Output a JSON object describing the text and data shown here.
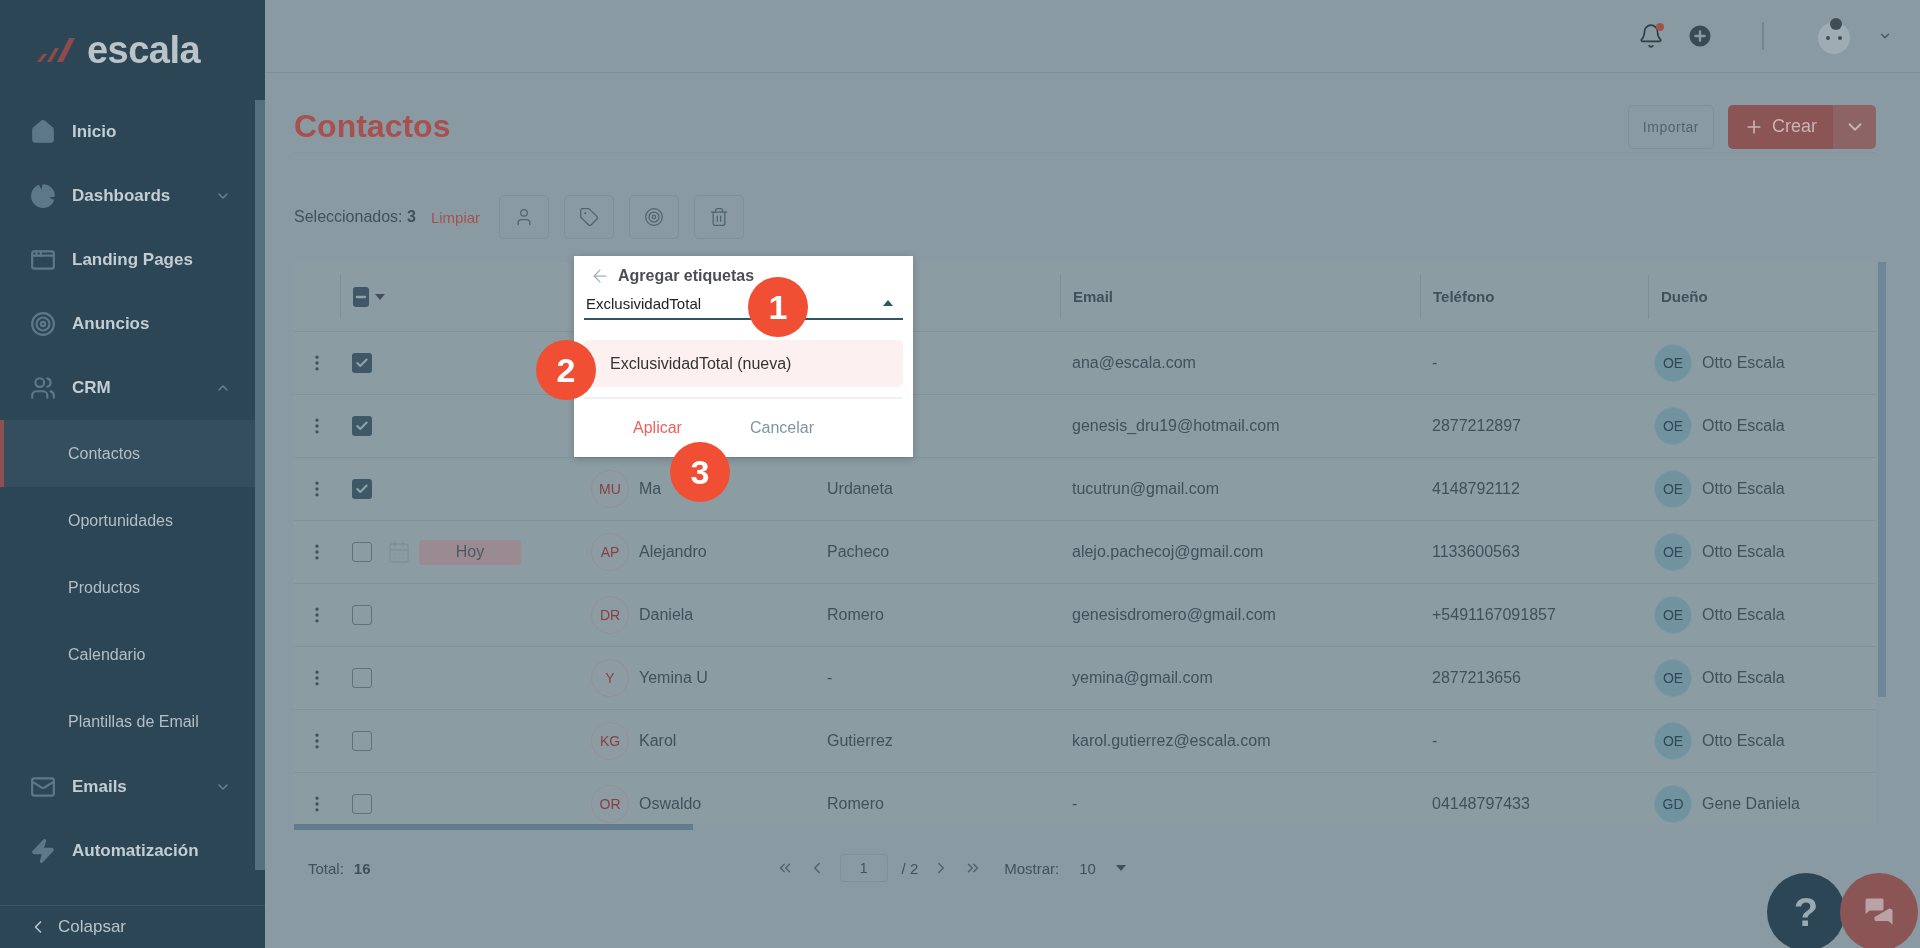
{
  "sidebar": {
    "logo": "escala",
    "items": [
      {
        "kind": "section",
        "label": "Inicio",
        "selected": false
      },
      {
        "kind": "section",
        "label": "Dashboards",
        "selected": false,
        "expanded": false
      },
      {
        "kind": "section",
        "label": "Landing Pages",
        "selected": false
      },
      {
        "kind": "section",
        "label": "Anuncios",
        "selected": false
      },
      {
        "kind": "section",
        "label": "CRM",
        "selected": false,
        "expanded": true
      },
      {
        "kind": "subitem",
        "label": "Contactos",
        "selected": true
      },
      {
        "kind": "subitem",
        "label": "Oportunidades",
        "selected": false
      },
      {
        "kind": "subitem",
        "label": "Productos",
        "selected": false
      },
      {
        "kind": "subitem",
        "label": "Calendario",
        "selected": false
      },
      {
        "kind": "subitem",
        "label": "Plantillas de Email",
        "selected": false
      },
      {
        "kind": "section",
        "label": "Emails",
        "selected": false,
        "expanded": false
      },
      {
        "kind": "section",
        "label": "Automatización",
        "selected": false
      }
    ],
    "collapse": "Colapsar"
  },
  "page": {
    "title": "Contactos",
    "import_button": "Importar",
    "create_button": "Crear"
  },
  "toolbar": {
    "selection": "Seleccionados: **3**",
    "clear": "Limpiar"
  },
  "table": {
    "header_indeterminate": true,
    "columns": [
      "Email",
      "Teléfono",
      "Dueño"
    ],
    "rows": [
      {
        "checked": true,
        "email": "ana@escala.com",
        "phone": "-",
        "owner_initials": "OE",
        "owner": "Otto Escala"
      },
      {
        "checked": true,
        "email": "genesis_dru19@hotmail.com",
        "phone": "2877212897",
        "owner_initials": "OE",
        "owner": "Otto Escala"
      },
      {
        "checked": true,
        "initials": "MU",
        "first_name": "Ma",
        "last_name": "Urdaneta",
        "email": "tucutrun@gmail.com",
        "phone": "4148792112",
        "owner_initials": "OE",
        "owner": "Otto Escala"
      },
      {
        "checked": false,
        "due": "Hoy",
        "initials": "AP",
        "first_name": "Alejandro",
        "last_name": "Pacheco",
        "email": "alejo.pachecoj@gmail.com",
        "phone": "1133600563",
        "owner_initials": "OE",
        "owner": "Otto Escala"
      },
      {
        "checked": false,
        "initials": "DR",
        "first_name": "Daniela",
        "last_name": "Romero",
        "email": "genesisdromero@gmail.com",
        "phone": "+5491167091857",
        "owner_initials": "OE",
        "owner": "Otto Escala"
      },
      {
        "checked": false,
        "initials": "Y",
        "first_name": "Yemina U",
        "last_name": "-",
        "email": "yemina@gmail.com",
        "phone": "2877213656",
        "owner_initials": "OE",
        "owner": "Otto Escala"
      },
      {
        "checked": false,
        "initials": "KG",
        "first_name": "Karol",
        "last_name": "Gutierrez",
        "email": "karol.gutierrez@escala.com",
        "phone": "-",
        "owner_initials": "OE",
        "owner": "Otto Escala"
      },
      {
        "checked": false,
        "initials": "OR",
        "first_name": "Oswaldo",
        "last_name": "Romero",
        "email": "-",
        "phone": "04148797433",
        "owner_initials": "GD",
        "owner": "Gene Daniela"
      }
    ]
  },
  "footer": {
    "total_label": "Total:",
    "total": "16",
    "page": "1",
    "pages": "/ 2",
    "show_label": "Mostrar:",
    "show": "10"
  },
  "popup": {
    "title": "Agregar etiquetas",
    "value": "ExclusividadTotal",
    "options": [
      {
        "label": "ExclusividadTotal (nueva)",
        "selected": true
      }
    ],
    "apply": "Aplicar",
    "cancel": "Cancelar"
  },
  "steps": [
    "1",
    "2",
    "3"
  ],
  "help": "?"
}
